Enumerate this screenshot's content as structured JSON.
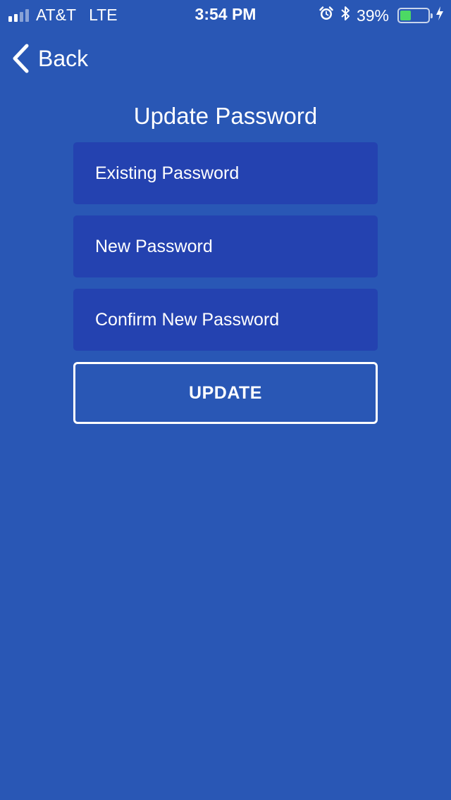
{
  "status_bar": {
    "carrier": "AT&T",
    "network": "LTE",
    "time": "3:54 PM",
    "battery_percent": "39%",
    "battery_level": 0.39,
    "signal_bars_filled": 2,
    "signal_bars_total": 4,
    "icons": [
      "alarm-icon",
      "bluetooth-icon",
      "charging-bolt-icon"
    ],
    "battery_color": "#4cd964"
  },
  "nav": {
    "back_label": "Back"
  },
  "page": {
    "title": "Update Password"
  },
  "form": {
    "existing_password": {
      "value": "",
      "placeholder": "Existing Password"
    },
    "new_password": {
      "value": "",
      "placeholder": "New Password"
    },
    "confirm_password": {
      "value": "",
      "placeholder": "Confirm New Password"
    },
    "submit_label": "UPDATE"
  },
  "colors": {
    "background": "#2957b5",
    "field_background": "#2442b0",
    "text": "#ffffff"
  }
}
